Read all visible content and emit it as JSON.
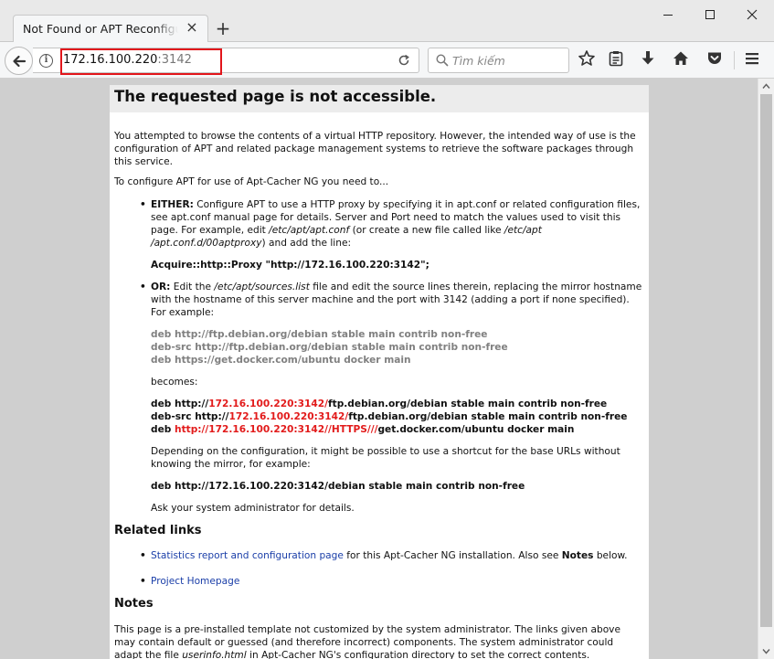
{
  "browser": {
    "tab_title": "Not Found or APT Reconfiguration required",
    "url_host": "172.16.100.220",
    "url_port": ":3142",
    "search_placeholder": "Tìm kiếm"
  },
  "page": {
    "heading": "The requested page is not accessible.",
    "intro": "You attempted to browse the contents of a virtual HTTP repository. However, the intended way of use is the configuration of APT and related package management systems to retrieve the software packages through this service.",
    "configure_lead": "To configure APT for use of Apt-Cacher NG you need to...",
    "either": {
      "label": "EITHER:",
      "text_1": " Configure APT to use a HTTP proxy by specifying it in apt.conf or related configuration files, see apt.conf manual page for details. Server and Port need to match the values used to visit this page. For example, edit ",
      "path_1": "/etc/apt/apt.conf",
      "text_2": " (or create a new file called like ",
      "path_2": "/etc/apt /apt.conf.d/00aptproxy",
      "text_3": ") and add the line:",
      "proxy_line": "Acquire::http::Proxy \"http://172.16.100.220:3142\";"
    },
    "or": {
      "label": "OR:",
      "text_1": " Edit the ",
      "path": "/etc/apt/sources.list",
      "text_2": " file and edit the source lines therein, replacing the mirror hostname with the hostname of this server machine and the port with 3142 (adding a port if none specified). For example:",
      "orig_1": "deb http://ftp.debian.org/debian stable main contrib non-free",
      "orig_2": "deb-src http://ftp.debian.org/debian stable main contrib non-free",
      "orig_3": "deb https://get.docker.com/ubuntu docker main",
      "becomes": "becomes:",
      "new_1_pre": "deb http://",
      "new_1_red": "172.16.100.220:3142/",
      "new_1_post": "ftp.debian.org/debian stable main contrib non-free",
      "new_2_pre": "deb-src http://",
      "new_2_red": "172.16.100.220:3142/",
      "new_2_post": "ftp.debian.org/debian stable main contrib non-free",
      "new_3_pre": "deb ",
      "new_3_red": "http://172.16.100.220:3142//HTTPS///",
      "new_3_post": "get.docker.com/ubuntu docker main",
      "shortcut_text": "Depending on the configuration, it might be possible to use a shortcut for the base URLs without knowing the mirror, for example:",
      "shortcut_line": "deb http://172.16.100.220:3142/debian stable main contrib non-free",
      "ask_admin": "Ask your system administrator for details."
    },
    "related_links": {
      "heading": "Related links",
      "stats_link": "Statistics report and configuration page",
      "stats_text_1": " for this Apt-Cacher NG installation. Also see ",
      "stats_notes": "Notes",
      "stats_text_2": " below.",
      "homepage_link": "Project Homepage"
    },
    "notes": {
      "heading": "Notes",
      "text_1": "This page is a pre-installed template not customized by the system administrator. The links given above may contain default or guessed (and therefore incorrect) components. The system administrator could adapt the file ",
      "file": "userinfo.html",
      "text_2": " in Apt-Cacher NG's configuration directory to set the correct contents."
    }
  },
  "bullet_char": "•"
}
